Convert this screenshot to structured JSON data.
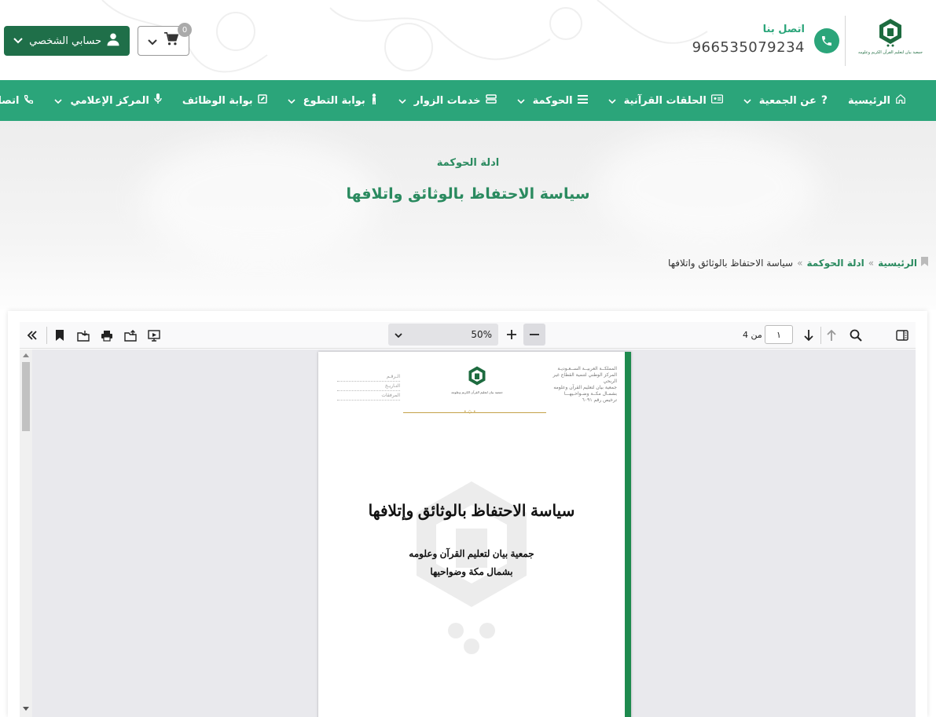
{
  "header": {
    "logo_text": "جمعية بيان لتعليم القرآن الكريم وعلومه",
    "contact_title": "اتصل بنا",
    "contact_number": "966535079234",
    "account_label": "حسابي الشخصي",
    "cart_count": "0"
  },
  "colors": {
    "brand_green": "#2ba57a",
    "dark_green": "#1f6f49",
    "title_green": "#2a8a5f"
  },
  "nav": {
    "items": [
      {
        "label": "الرئيسية",
        "icon": "home-icon",
        "has_dropdown": false
      },
      {
        "label": "عن الجمعية",
        "icon": "question-icon",
        "has_dropdown": true
      },
      {
        "label": "الحلقات القرآنية",
        "icon": "id-card-icon",
        "has_dropdown": true
      },
      {
        "label": "الحوكمة",
        "icon": "list-icon",
        "has_dropdown": true
      },
      {
        "label": "خدمات الزوار",
        "icon": "server-icon",
        "has_dropdown": true
      },
      {
        "label": "بوابة التطوع",
        "icon": "person-icon",
        "has_dropdown": true
      },
      {
        "label": "بوابة الوظائف",
        "icon": "edit-icon",
        "has_dropdown": false
      },
      {
        "label": "المركز الإعلامي",
        "icon": "microphone-icon",
        "has_dropdown": true
      },
      {
        "label": "اتصل بنا",
        "icon": "phone-icon",
        "has_dropdown": true
      }
    ]
  },
  "hero": {
    "subtitle": "ادلة الحوكمة",
    "title": "سياسة الاحتفاظ بالوثائق واتلافها"
  },
  "breadcrumb": {
    "home": "الرئيسية",
    "separator": "»",
    "parent": "ادلة الحوكمة",
    "current": "سياسة الاحتفاظ بالوثائق واتلافها"
  },
  "pdf_viewer": {
    "zoom": "50%",
    "page_number": "١",
    "page_of": "من 4"
  },
  "pdf_page": {
    "header_right": [
      "المملكــة العربيــة الســعـوديـة",
      "المركز الوطني لتنمية القطاع غير الربحي",
      "جمعية بيان لتعليم القرآن وعلومه",
      "بشمـال مكــة وضـواحـيهـــا",
      "ترخيص رقم ٦٠٩١"
    ],
    "header_left": [
      "الـرقـم",
      "التـاريـخ",
      "المرفقات"
    ],
    "logo_text": "جمعية بيان لتعليم القرآن الكريم وعلومه",
    "doc_title": "سياسة الاحتفاظ بالوثائق وإتلافها",
    "doc_sub1": "جمعية بيان لتعليم القرآن وعلومه",
    "doc_sub2": "بشمال مكة وضواحيها"
  }
}
